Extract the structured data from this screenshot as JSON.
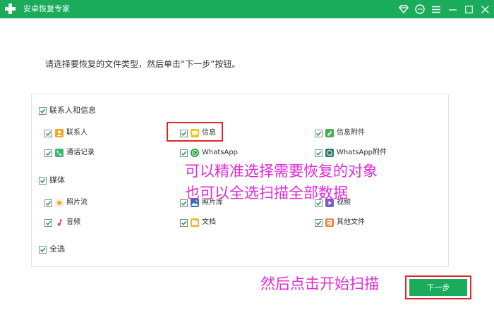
{
  "window": {
    "title": "安卓恢复专家",
    "accent_color": "#1aab5b",
    "controls": [
      "diamond-icon",
      "chat-icon",
      "menu-icon",
      "minimize-icon",
      "maximize-icon",
      "close-icon"
    ]
  },
  "instruction": "请选择要恢复的文件类型，然后单击“下一步”按钮。",
  "groups": [
    {
      "label": "联系人和信息",
      "checked": true,
      "items": [
        {
          "label": "联系人",
          "icon": "contacts-icon",
          "checked": true
        },
        {
          "label": "信息",
          "icon": "message-icon",
          "checked": true
        },
        {
          "label": "信息附件",
          "icon": "attachment-icon",
          "checked": true
        },
        {
          "label": "通话记录",
          "icon": "phone-icon",
          "checked": true
        },
        {
          "label": "WhatsApp",
          "icon": "whatsapp-icon",
          "checked": true
        },
        {
          "label": "WhatsApp附件",
          "icon": "whatsapp-attachment-icon",
          "checked": true
        }
      ]
    },
    {
      "label": "媒体",
      "checked": true,
      "items": [
        {
          "label": "照片流",
          "icon": "photostream-icon",
          "checked": true
        },
        {
          "label": "照片库",
          "icon": "photo-library-icon",
          "checked": true
        },
        {
          "label": "视频",
          "icon": "video-icon",
          "checked": true
        },
        {
          "label": "音频",
          "icon": "audio-icon",
          "checked": true
        },
        {
          "label": "文档",
          "icon": "document-icon",
          "checked": true
        },
        {
          "label": "其他文件",
          "icon": "other-files-icon",
          "checked": true
        }
      ]
    }
  ],
  "select_all": {
    "label": "全选",
    "checked": true
  },
  "annotations": {
    "line1": "可以精准选择需要恢复的对象",
    "line2": "也可以全选扫描全部数据",
    "line3": "然后点击开始扫描",
    "color": "#e02bd6",
    "box_color": "#e0262b"
  },
  "next_button": {
    "label": "下一步"
  }
}
